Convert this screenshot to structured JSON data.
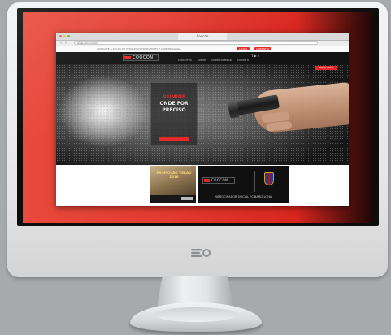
{
  "browser": {
    "tab_title": "Coocon",
    "url": "www.coocon.com",
    "nav_back": "‹",
    "nav_forward": "›"
  },
  "site": {
    "topstrip_text": "CONSULTE A SECAO DE PERGUNTAS FREQUENTES E COMPRE AGORA",
    "top_buttons": [
      "LOGIN",
      "CARRINHO"
    ],
    "logo_text": "COOCON",
    "menu": [
      "PRODUTOS",
      "SOBRE",
      "ONDE COMPRAR",
      "CONTATO"
    ],
    "header_icons": "f  t  ▶  ⌕",
    "hero": {
      "title_line1": "ILUMINE",
      "title_line2": "ONDE FOR",
      "title_line3": "PRECISO",
      "badge": "SAIBA MAIS"
    },
    "promo_left": {
      "text": "PROMOÇÃO VERÃO 2016"
    },
    "promo_right": {
      "logo_text": "COOCON",
      "caption": "PATROCINADOR OFICIAL FC BARCELONA"
    }
  },
  "colors": {
    "accent": "#e5292a",
    "wallpaper": "#e33b2f",
    "header": "#131313"
  },
  "icons": [
    "power-logo-icon",
    "fc-barcelona-crest-icon",
    "flashlight-icon",
    "hand-icon"
  ]
}
